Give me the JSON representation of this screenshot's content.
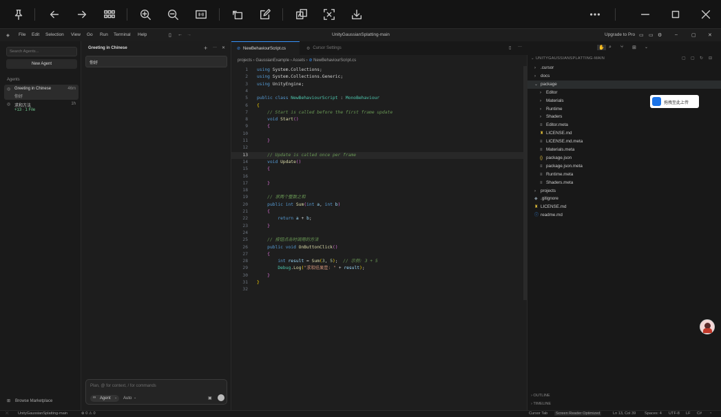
{
  "app": {
    "window_title": "UnityGaussianSplatting-main",
    "upgrade": "Upgrade to Pro"
  },
  "menu": [
    "File",
    "Edit",
    "Selection",
    "View",
    "Go",
    "Run",
    "Terminal",
    "Help"
  ],
  "agents": {
    "search_placeholder": "Search Agents...",
    "new_agent": "New Agent",
    "section": "Agents",
    "items": [
      {
        "title": "Greeting in Chinese",
        "sub": "你好",
        "time": "46m"
      },
      {
        "title": "求和方法",
        "sub": "+13 · 1 File",
        "time": "1h"
      }
    ],
    "marketplace": "Browse Marketplace"
  },
  "chat": {
    "title": "Greeting in Chinese",
    "message": "你好",
    "input_placeholder": "Plan, @ for context, / for commands",
    "mode": "Agent",
    "model": "Auto"
  },
  "editor": {
    "tabs": [
      {
        "label": "NewBehaviourScript.cs",
        "active": true
      },
      {
        "label": "Cursor Settings",
        "active": false
      }
    ],
    "breadcrumb": [
      "projects",
      "GaussianExample",
      "Assets",
      "NewBehaviourScript.cs"
    ],
    "current_line": 13
  },
  "explorer": {
    "root": "UNITYGAUSSIANSPLATTING-MAIN",
    "items": [
      {
        "label": ".cursor",
        "type": "folder",
        "depth": 0,
        "open": false
      },
      {
        "label": "docs",
        "type": "folder",
        "depth": 0,
        "open": false
      },
      {
        "label": "package",
        "type": "folder",
        "depth": 0,
        "open": true
      },
      {
        "label": "Editor",
        "type": "folder",
        "depth": 1,
        "open": false
      },
      {
        "label": "Materials",
        "type": "folder",
        "depth": 1,
        "open": false
      },
      {
        "label": "Runtime",
        "type": "folder",
        "depth": 1,
        "open": false
      },
      {
        "label": "Shaders",
        "type": "folder",
        "depth": 1,
        "open": false
      },
      {
        "label": "Editor.meta",
        "type": "meta",
        "depth": 1
      },
      {
        "label": "LICENSE.md",
        "type": "license",
        "depth": 1
      },
      {
        "label": "LICENSE.md.meta",
        "type": "meta",
        "depth": 1
      },
      {
        "label": "Materials.meta",
        "type": "meta",
        "depth": 1
      },
      {
        "label": "package.json",
        "type": "json",
        "depth": 1
      },
      {
        "label": "package.json.meta",
        "type": "meta",
        "depth": 1
      },
      {
        "label": "Runtime.meta",
        "type": "meta",
        "depth": 1
      },
      {
        "label": "Shaders.meta",
        "type": "meta",
        "depth": 1
      },
      {
        "label": "projects",
        "type": "folder",
        "depth": 0,
        "open": false
      },
      {
        "label": ".gitignore",
        "type": "git",
        "depth": 0
      },
      {
        "label": "LICENSE.md",
        "type": "license",
        "depth": 0
      },
      {
        "label": "readme.md",
        "type": "info",
        "depth": 0
      }
    ],
    "outline": "OUTLINE",
    "timeline": "TIMELINE",
    "upload_badge": "拖拽至此上传"
  },
  "status": {
    "branch": "UnityGaussianSplatting-main",
    "problems": "⊗ 0 ⚠ 0",
    "cursor_tab": "Cursor Tab",
    "reader": "Screen Reader Optimized",
    "position": "Ln 13, Col 39",
    "spaces": "Spaces: 4",
    "encoding": "UTF-8",
    "eol": "LF",
    "lang": "C#"
  },
  "colors": {
    "accent": "#3794ff",
    "bg": "#1e1e1e"
  }
}
